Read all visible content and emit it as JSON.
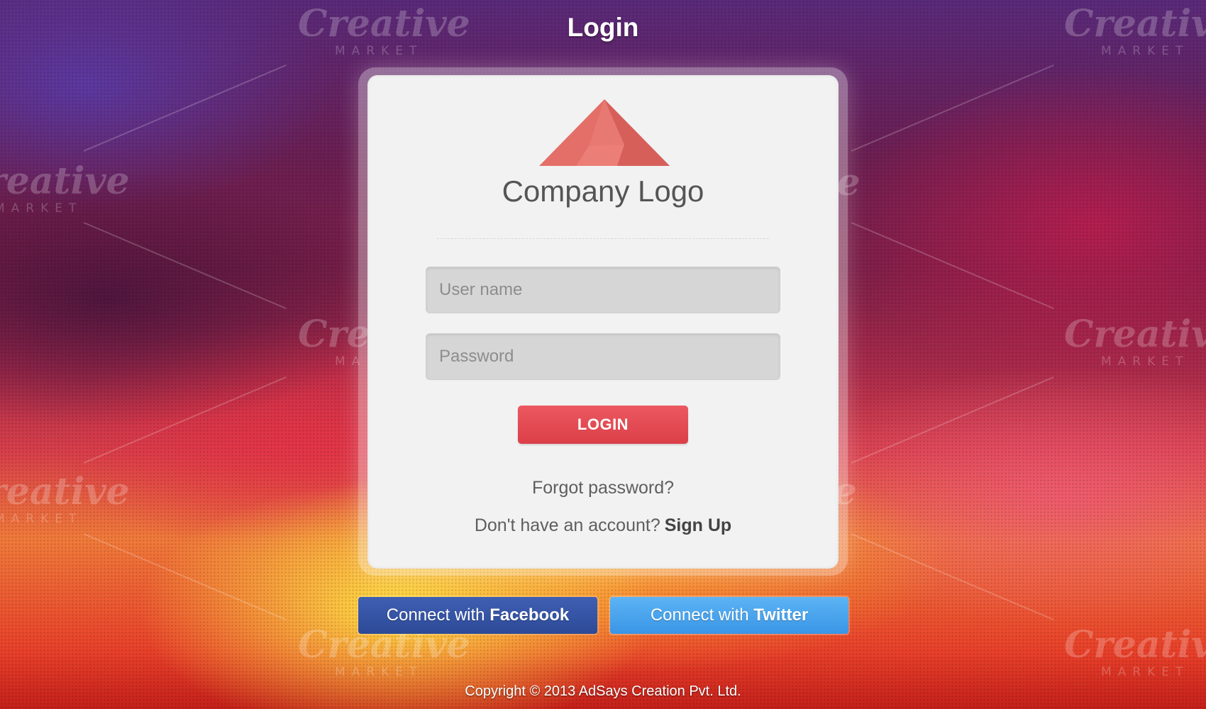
{
  "header": {
    "title": "Login"
  },
  "brand": {
    "logo_text": "Company Logo",
    "accent_color": "#e0675f"
  },
  "form": {
    "username": {
      "placeholder": "User name",
      "value": ""
    },
    "password": {
      "placeholder": "Password",
      "value": ""
    },
    "login_button": "LOGIN",
    "forgot_password": "Forgot password?",
    "no_account_text": "Don't have an account?",
    "signup_link": "Sign Up"
  },
  "social": {
    "facebook": {
      "prefix": "Connect with",
      "name": "Facebook",
      "color": "#2d4a98"
    },
    "twitter": {
      "prefix": "Connect with",
      "name": "Twitter",
      "color": "#3a95e6"
    }
  },
  "footer": {
    "copyright": "Copyright © 2013 AdSays Creation Pvt. Ltd."
  },
  "watermark": {
    "brand": "Creative",
    "sub": "MARKET"
  }
}
